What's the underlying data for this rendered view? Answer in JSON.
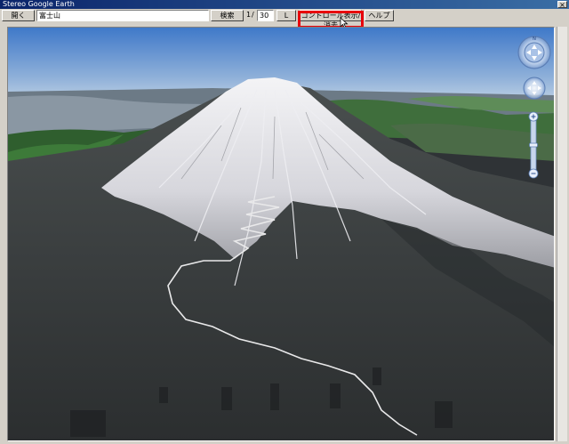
{
  "window": {
    "title": "Stereo Google Earth",
    "close_glyph": "×"
  },
  "toolbar": {
    "open_label": "開く",
    "search_value": "富士山",
    "search_label": "検索",
    "page_current": "1",
    "page_separator": "/",
    "page_total": "30",
    "next_label": "L",
    "toggle_controls_label": "コントロール表示/消去",
    "help_label": "ヘルプ"
  },
  "colors": {
    "highlight": "#e8000b",
    "sky_top": "#3f79c9",
    "sky_bottom": "#b8cde3"
  },
  "icons": [
    "navigation-compass-icon",
    "look-around-icon",
    "zoom-slider-icon",
    "mouse-pointer-icon"
  ]
}
